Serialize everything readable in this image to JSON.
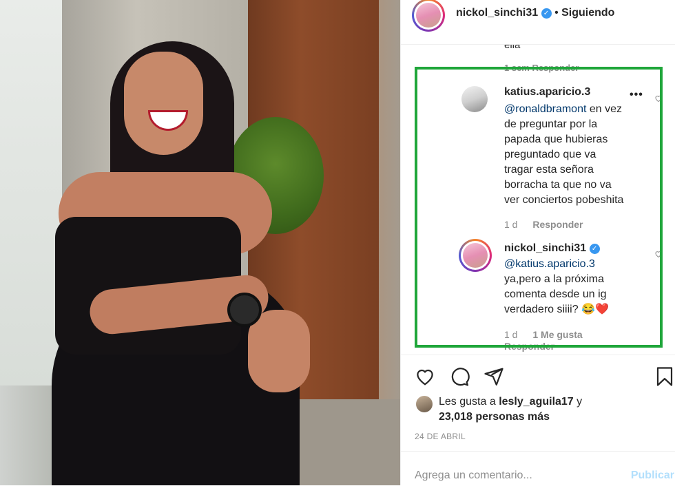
{
  "post": {
    "author": "nickol_sinchi31",
    "follow_status": "Siguiendo",
    "verified": true
  },
  "comments_cut": {
    "text": "ella",
    "meta": "1 sem   Responder"
  },
  "comments": [
    {
      "author": "katius.aparicio.3",
      "mention": "@ronaldbramont",
      "text_lines": [
        "en vez",
        "de preguntar por la",
        "papada que hubieras",
        "preguntado que va",
        "tragar esta señora",
        "borracha ta que no va",
        "ver conciertos pobeshita"
      ],
      "time": "1 d",
      "reply_label": "Responder"
    },
    {
      "author": "nickol_sinchi31",
      "verified": true,
      "mention": "@katius.aparicio.3",
      "text_lines": [
        "ya,pero a la próxima",
        "comenta desde un ig",
        "verdadero siiii? 😂❤️"
      ],
      "time": "1 d",
      "likes_label": "1 Me gusta",
      "reply_label": "Responder"
    }
  ],
  "likes": {
    "prefix": "Les gusta a",
    "first_liker": "lesly_aguila17",
    "joiner": "y",
    "others": "23,018 personas más"
  },
  "date": "24 DE ABRIL",
  "add_comment": {
    "placeholder": "Agrega un comentario...",
    "publish_label": "Publicar"
  },
  "colors": {
    "highlight_border": "#1fa63a",
    "verified": "#3897f0",
    "mention": "#00376b",
    "publish_disabled": "#b2dffc"
  },
  "icons": [
    "heart-icon",
    "comment-icon",
    "share-icon",
    "bookmark-icon",
    "more-icon",
    "verified-icon"
  ]
}
